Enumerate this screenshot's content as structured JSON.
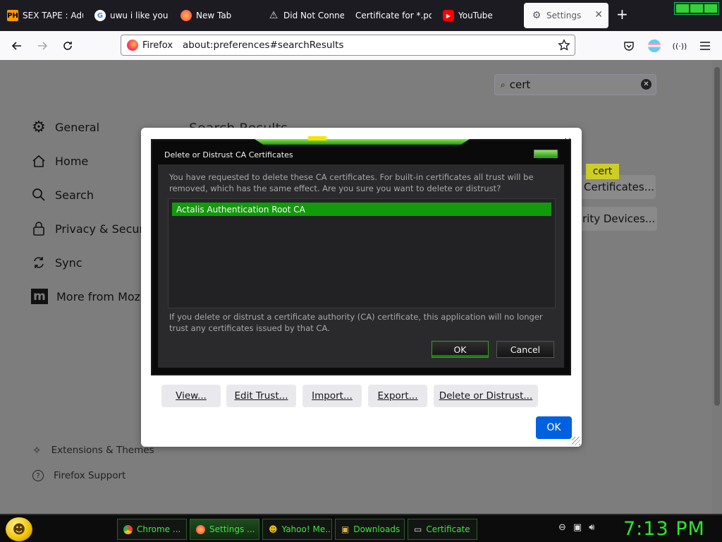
{
  "tabs": [
    {
      "title": "SEX TAPE : Adu",
      "icon": "PH"
    },
    {
      "title": "uwu i like you",
      "icon": "G"
    },
    {
      "title": "New Tab",
      "icon": "firefox"
    },
    {
      "title": "Did Not Conne",
      "icon": "warning"
    },
    {
      "title": "Certificate for *.po",
      "icon": ""
    },
    {
      "title": "YouTube",
      "icon": "youtube"
    },
    {
      "title": "Settings",
      "icon": "gear"
    }
  ],
  "urlbar": {
    "identity": "Firefox",
    "url": "about:preferences#searchResults"
  },
  "settings": {
    "search_value": "cert",
    "search_results_title": "Search Results",
    "nav": {
      "general": "General",
      "home": "Home",
      "search": "Search",
      "privacy": "Privacy & Security",
      "sync": "Sync",
      "more": "More from Mozill"
    },
    "footer": {
      "extensions": "Extensions & Themes",
      "support": "Firefox Support"
    },
    "highlight": "cert",
    "view_certs_button": "Certificates...",
    "security_devices_button": "rity Devices..."
  },
  "cert_manager": {
    "buttons": {
      "view": "View...",
      "edit_trust": "Edit Trust...",
      "import": "Import...",
      "export": "Export...",
      "delete": "Delete or Distrust..."
    },
    "ok": "OK"
  },
  "confirm_dialog": {
    "title": "Delete or Distrust CA Certificates",
    "message": "You have requested to delete these CA certificates. For built-in certificates all trust will be removed, which has the same effect. Are you sure you want to delete or distrust?",
    "items": [
      "Actalis Authentication Root CA"
    ],
    "note": "If you delete or distrust a certificate authority (CA) certificate, this application will no longer trust any certificates issued by that CA.",
    "ok": "OK",
    "cancel": "Cancel"
  },
  "taskbar": {
    "buttons": [
      {
        "label": "Chrome ...",
        "icon": "chrome"
      },
      {
        "label": "Settings ...",
        "icon": "firefox"
      },
      {
        "label": "Yahoo! Me...",
        "icon": "yahoo"
      },
      {
        "label": "Downloads",
        "icon": "folder"
      },
      {
        "label": "Certificate",
        "icon": "document"
      }
    ],
    "clock": "7:13 PM"
  },
  "colors": {
    "accent_blue": "#0061e0",
    "theme_green": "#139a0c",
    "clock_green": "#2ee62e"
  }
}
